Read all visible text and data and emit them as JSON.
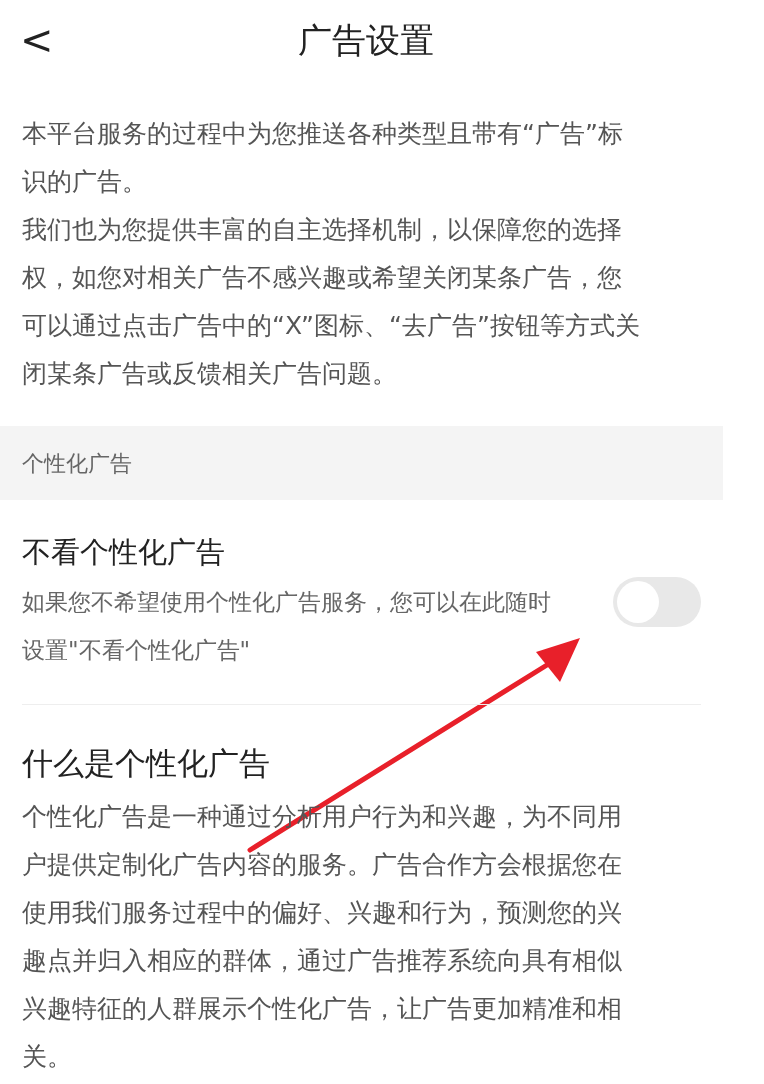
{
  "header": {
    "back": "<",
    "title": "广告设置"
  },
  "intro": [
    "本平台服务的过程中为您推送各种类型且带有“广告”标识的广告。",
    "我们也为您提供丰富的自主选择机制，以保障您的选择权，如您对相关广告不感兴趣或希望关闭某条广告，您可以通过点击广告中的“X”图标、“去广告”按钮等方式关闭某条广告或反馈相关广告问题。"
  ],
  "section": {
    "title": "个性化广告"
  },
  "setting": {
    "title": "不看个性化广告",
    "description": "如果您不希望使用个性化广告服务，您可以在此随时设置\"不看个性化广告\"",
    "on": false
  },
  "info": {
    "title": "什么是个性化广告",
    "body": "个性化广告是一种通过分析用户行为和兴趣，为不同用户提供定制化广告内容的服务。广告合作方会根据您在使用我们服务过程中的偏好、兴趣和行为，预测您的兴趣点并归入相应的群体，通过广告推荐系统向具有相似兴趣特征的人群展示个性化广告，让广告更加精准和相关。"
  }
}
